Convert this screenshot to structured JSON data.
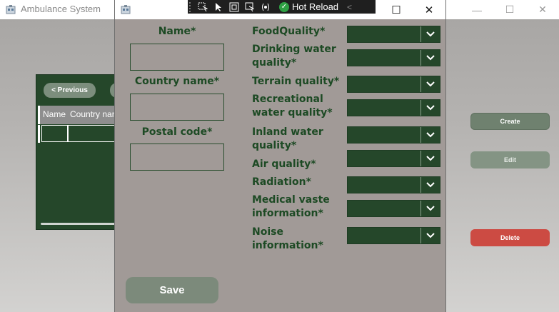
{
  "background_window": {
    "title": "Ambulance System",
    "controls": {
      "minimize": "—",
      "maximize": "☐",
      "close": "✕"
    },
    "previous_label": "< Previous",
    "grid_columns": [
      "Name",
      "Country nar"
    ],
    "create_label": "Create",
    "edit_label": "Edit",
    "delete_label": "Delete"
  },
  "dialog": {
    "controls": {
      "maximize": "☐",
      "close": "✕"
    },
    "hot_reload_label": "Hot Reload",
    "left_fields": [
      {
        "label": "Name*",
        "value": ""
      },
      {
        "label": "Country name*",
        "value": ""
      },
      {
        "label": "Postal code*",
        "value": ""
      }
    ],
    "quality_fields": [
      {
        "label_1": "FoodQuality*",
        "label_2": "",
        "value": ""
      },
      {
        "label_1": "Drinking water",
        "label_2": "quality*",
        "value": ""
      },
      {
        "label_1": "Terrain quality*",
        "label_2": "",
        "value": ""
      },
      {
        "label_1": "Recreational",
        "label_2": "water quality*",
        "value": ""
      },
      {
        "label_1": "Inland water",
        "label_2": "quality*",
        "value": ""
      },
      {
        "label_1": "Air quality*",
        "label_2": "",
        "value": ""
      },
      {
        "label_1": "Radiation*",
        "label_2": "",
        "value": ""
      },
      {
        "label_1": "Medical vaste",
        "label_2": "information*",
        "value": ""
      },
      {
        "label_1": "Noise",
        "label_2": "information*",
        "value": ""
      }
    ],
    "save_label": "Save"
  },
  "colors": {
    "dark_green": "#25472a",
    "label_green": "#1d4a24",
    "dialog_bg": "#a19a97",
    "delete_red": "#cc4b43"
  },
  "icons": [
    "app-icon",
    "select-element-icon",
    "pointer-icon",
    "layout-adorner-icon",
    "track-focus-icon",
    "binding-failures-icon",
    "hot-reload-check-icon",
    "chevron-down-icon"
  ]
}
